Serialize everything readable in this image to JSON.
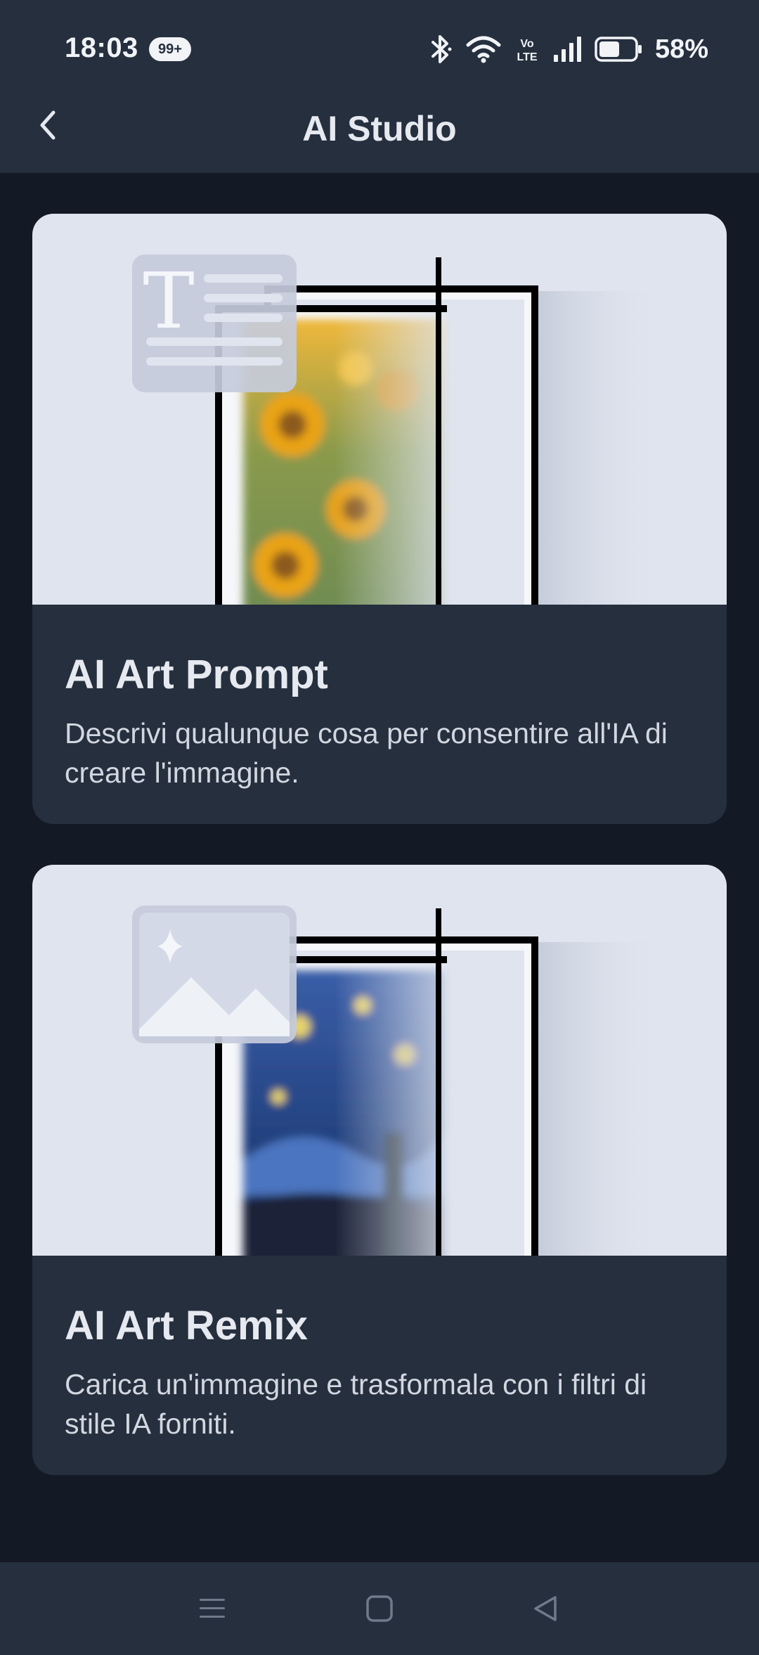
{
  "status_bar": {
    "time": "18:03",
    "notification_badge": "99+",
    "network_label": "Vo LTE",
    "battery_percent": "58%",
    "battery_level": 0.58
  },
  "header": {
    "title": "AI Studio",
    "back_icon": "chevron-left-icon"
  },
  "cards": [
    {
      "title": "AI Art Prompt",
      "description": "Descrivi qualunque cosa per consentire all'IA di creare l'immagine.",
      "icon": "text-document-icon",
      "artwork": "sunflowers-painting"
    },
    {
      "title": "AI Art Remix",
      "description": "Carica un'immagine e trasformala con i filtri di stile IA forniti.",
      "icon": "image-sparkle-icon",
      "artwork": "starry-night-painting"
    }
  ],
  "nav_bar": {
    "menu_icon": "menu-icon",
    "home_icon": "home-square-icon",
    "back_icon": "back-triangle-icon"
  },
  "colors": {
    "background": "#141a25",
    "surface": "#252f3e",
    "card_art_bg": "#dfe4ee",
    "text_primary": "#e6e9ef"
  }
}
